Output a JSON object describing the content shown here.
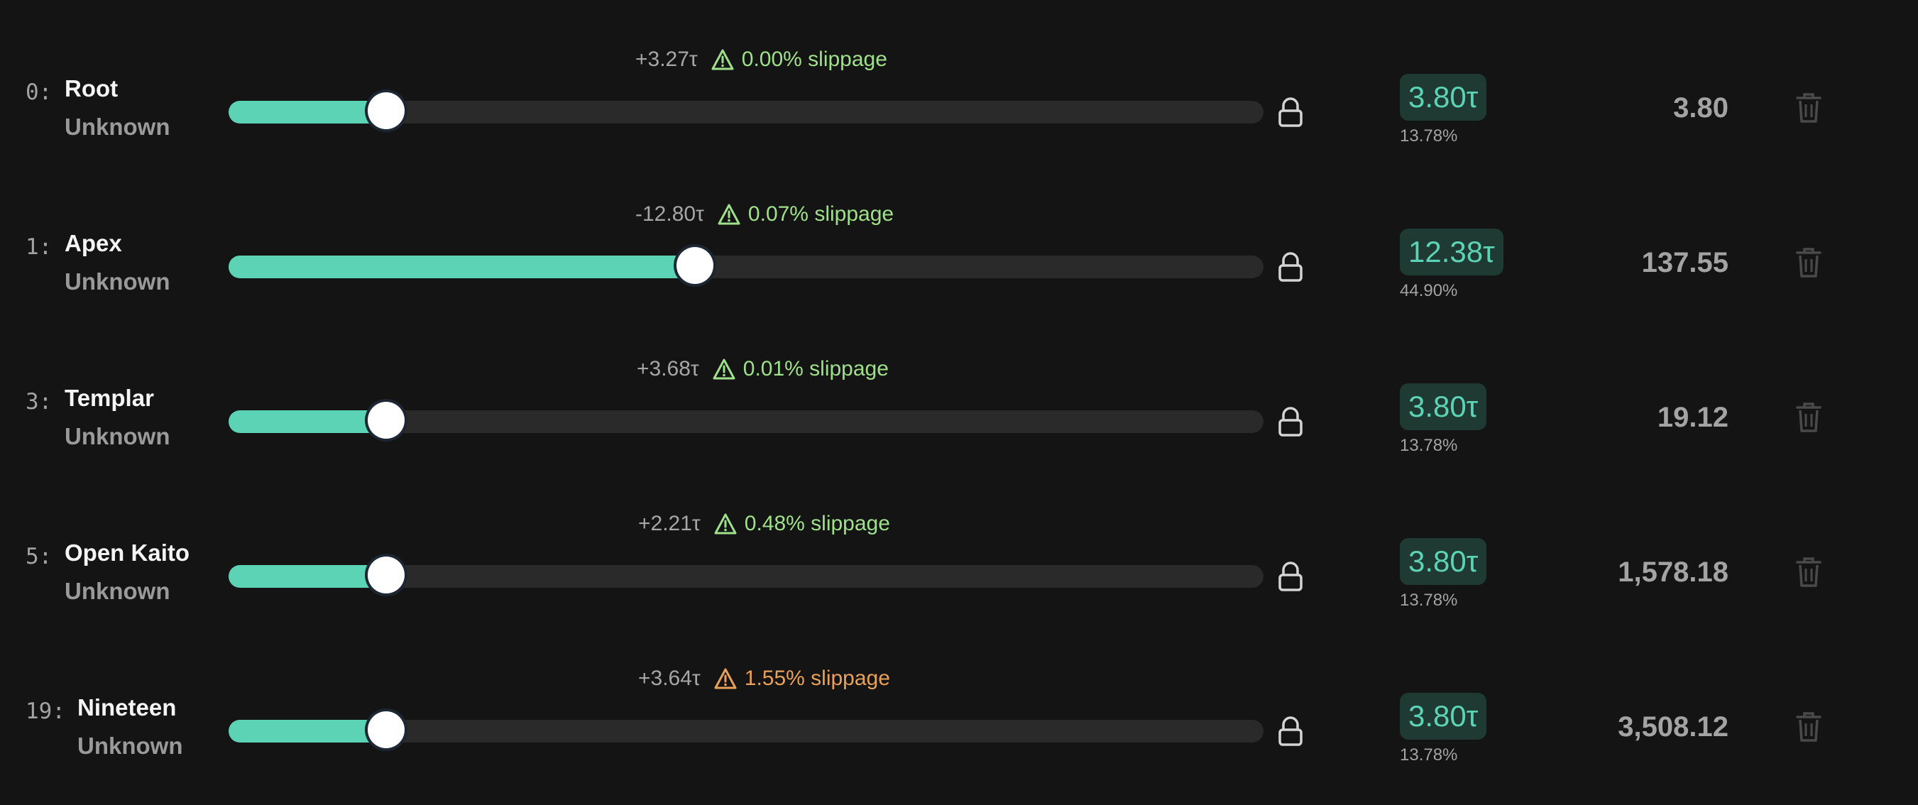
{
  "colors": {
    "background": "#141414",
    "accent": "#5dd3b6",
    "track": "#2a2a2a",
    "slippage_ok": "#9fe08a",
    "slippage_warn": "#e9a15a",
    "chip_bg": "#1e3a33",
    "muted_text": "#a3a3a3"
  },
  "icons": {
    "warning": "warning-triangle-icon",
    "lock": "lock-icon",
    "delete": "trash-icon"
  },
  "rows": [
    {
      "netuid": "0:",
      "name": "Root",
      "owner": "Unknown",
      "delta": "+3.27τ",
      "slippage": "0.00% slippage",
      "slippage_level": "ok",
      "allocation_fraction": 0.1378,
      "stake_amount": "3.80τ",
      "stake_percent": "13.78%",
      "value": "3.80"
    },
    {
      "netuid": "1:",
      "name": "Apex",
      "owner": "Unknown",
      "delta": "-12.80τ",
      "slippage": "0.07% slippage",
      "slippage_level": "ok",
      "allocation_fraction": 0.449,
      "stake_amount": "12.38τ",
      "stake_percent": "44.90%",
      "value": "137.55"
    },
    {
      "netuid": "3:",
      "name": "Templar",
      "owner": "Unknown",
      "delta": "+3.68τ",
      "slippage": "0.01% slippage",
      "slippage_level": "ok",
      "allocation_fraction": 0.1378,
      "stake_amount": "3.80τ",
      "stake_percent": "13.78%",
      "value": "19.12"
    },
    {
      "netuid": "5:",
      "name": "Open Kaito",
      "owner": "Unknown",
      "delta": "+2.21τ",
      "slippage": "0.48% slippage",
      "slippage_level": "ok",
      "allocation_fraction": 0.1378,
      "stake_amount": "3.80τ",
      "stake_percent": "13.78%",
      "value": "1,578.18"
    },
    {
      "netuid": "19:",
      "name": "Nineteen",
      "owner": "Unknown",
      "delta": "+3.64τ",
      "slippage": "1.55% slippage",
      "slippage_level": "warn",
      "allocation_fraction": 0.1378,
      "stake_amount": "3.80τ",
      "stake_percent": "13.78%",
      "value": "3,508.12"
    }
  ]
}
